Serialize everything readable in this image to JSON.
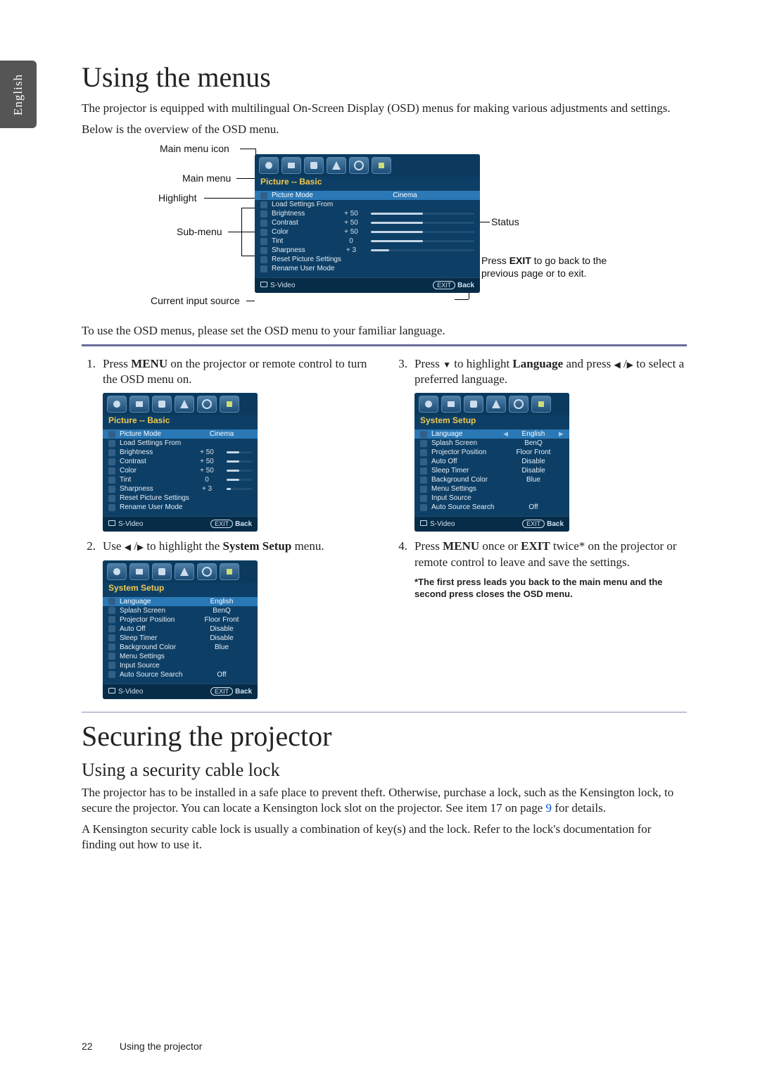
{
  "side_tab": "English",
  "section1_title": "Using the menus",
  "intro1": "The projector is equipped with multilingual On-Screen Display (OSD) menus for making various adjustments and settings.",
  "intro2": "Below is the overview of the OSD menu.",
  "overview_labels": {
    "main_menu_icon": "Main menu icon",
    "main_menu": "Main menu",
    "highlight": "Highlight",
    "sub_menu": "Sub-menu",
    "current_input": "Current input source",
    "status": "Status",
    "exit_hint": "Press EXIT to go back to the previous page or to exit.",
    "exit_hint_bold": "EXIT"
  },
  "osd_picture": {
    "title": "Picture -- Basic",
    "rows": [
      {
        "label": "Picture Mode",
        "value": "Cinema",
        "type": "select",
        "highlight": true
      },
      {
        "label": "Load Settings From",
        "type": "link"
      },
      {
        "label": "Brightness",
        "value": "+ 50",
        "type": "slider",
        "fill": 50
      },
      {
        "label": "Contrast",
        "value": "+ 50",
        "type": "slider",
        "fill": 50
      },
      {
        "label": "Color",
        "value": "+ 50",
        "type": "slider",
        "fill": 50
      },
      {
        "label": "Tint",
        "value": "0",
        "type": "slider",
        "fill": 50
      },
      {
        "label": "Sharpness",
        "value": "+ 3",
        "type": "slider",
        "fill": 18
      },
      {
        "label": "Reset Picture Settings",
        "type": "link"
      },
      {
        "label": "Rename User Mode",
        "type": "link"
      }
    ],
    "footer_source": "S-Video",
    "footer_exit": "EXIT",
    "footer_back": "Back"
  },
  "osd_system": {
    "title": "System Setup",
    "rows": [
      {
        "label": "Language",
        "value": "English",
        "highlight": true,
        "arrows": true
      },
      {
        "label": "Splash Screen",
        "value": "BenQ"
      },
      {
        "label": "Projector Position",
        "value": "Floor Front"
      },
      {
        "label": "Auto Off",
        "value": "Disable"
      },
      {
        "label": "Sleep Timer",
        "value": "Disable"
      },
      {
        "label": "Background Color",
        "value": "Blue"
      },
      {
        "label": "Menu Settings",
        "value": ""
      },
      {
        "label": "Input Source",
        "value": ""
      },
      {
        "label": "Auto Source Search",
        "value": "Off"
      }
    ],
    "footer_source": "S-Video",
    "footer_exit": "EXIT",
    "footer_back": "Back"
  },
  "after_overview": "To use the OSD menus, please set the OSD menu to your familiar language.",
  "steps": {
    "s1_num": "1.",
    "s1_a": "Press ",
    "s1_b": "MENU",
    "s1_c": " on the projector or remote control to turn the OSD menu on.",
    "s2_num": "2.",
    "s2_a": "Use ",
    "s2_b": " to highlight the ",
    "s2_c": "System Setup",
    "s2_d": " menu.",
    "s3_num": "3.",
    "s3_a": "Press ",
    "s3_b": " to highlight ",
    "s3_c": "Language",
    "s3_d": " and press ",
    "s3_e": " to select a preferred language.",
    "s4_num": "4.",
    "s4_a": "Press ",
    "s4_b": "MENU",
    "s4_c": " once or ",
    "s4_d": "EXIT",
    "s4_e": " twice* on the projector or remote control to leave and save the settings.",
    "note": "*The first press leads you back to the main menu and the second press closes the OSD menu."
  },
  "section2_title": "Securing the projector",
  "section2_sub": "Using a security cable lock",
  "secure_p1_a": "The projector has to be installed in a safe place to prevent theft. Otherwise, purchase a lock, such as the Kensington lock, to secure the projector. You can locate a Kensington lock slot on the projector. See item 17 on page ",
  "secure_p1_link": "9",
  "secure_p1_b": " for details.",
  "secure_p2": "A Kensington security cable lock is usually a combination of key(s) and the lock. Refer to the lock's documentation for finding out how to use it.",
  "footer": {
    "page": "22",
    "section": "Using the projector"
  }
}
